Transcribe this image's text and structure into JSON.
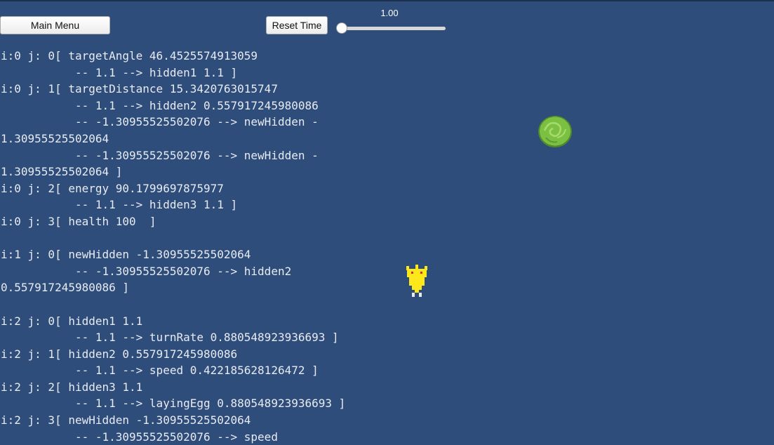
{
  "toolbar": {
    "main_menu_label": "Main Menu",
    "reset_time_label": "Reset Time",
    "time_scale_text": "1.00",
    "time_scale": 1.0
  },
  "log_lines": [
    "i:0 j: 0[ targetAngle 46.4525574913059",
    "           -- 1.1 --> hidden1 1.1 ]",
    "i:0 j: 1[ targetDistance 15.3420763015747",
    "           -- 1.1 --> hidden2 0.557917245980086",
    "           -- -1.30955525502076 --> newHidden -",
    "1.30955525502064",
    "           -- -1.30955525502076 --> newHidden -",
    "1.30955525502064 ]",
    "i:0 j: 2[ energy 90.1799697875977",
    "           -- 1.1 --> hidden3 1.1 ]",
    "i:0 j: 3[ health 100  ]",
    "",
    "i:1 j: 0[ newHidden -1.30955525502064",
    "           -- -1.30955525502076 --> hidden2",
    "0.557917245980086 ]",
    "",
    "i:2 j: 0[ hidden1 1.1",
    "           -- 1.1 --> turnRate 0.880548923936693 ]",
    "i:2 j: 1[ hidden2 0.557917245980086",
    "           -- 1.1 --> speed 0.422185628126472 ]",
    "i:2 j: 2[ hidden3 1.1",
    "           -- 1.1 --> layingEgg 0.880548923936693 ]",
    "i:2 j: 3[ newHidden -1.30955525502064",
    "           -- -1.30955525502076 --> speed"
  ],
  "sprites": {
    "food": "food-plant-icon",
    "creature": "yellow-creature-icon"
  },
  "colors": {
    "background": "#2f4d7b",
    "text": "#e7ebf2",
    "food_green": "#7bc043",
    "creature_yellow": "#ffe81a"
  }
}
